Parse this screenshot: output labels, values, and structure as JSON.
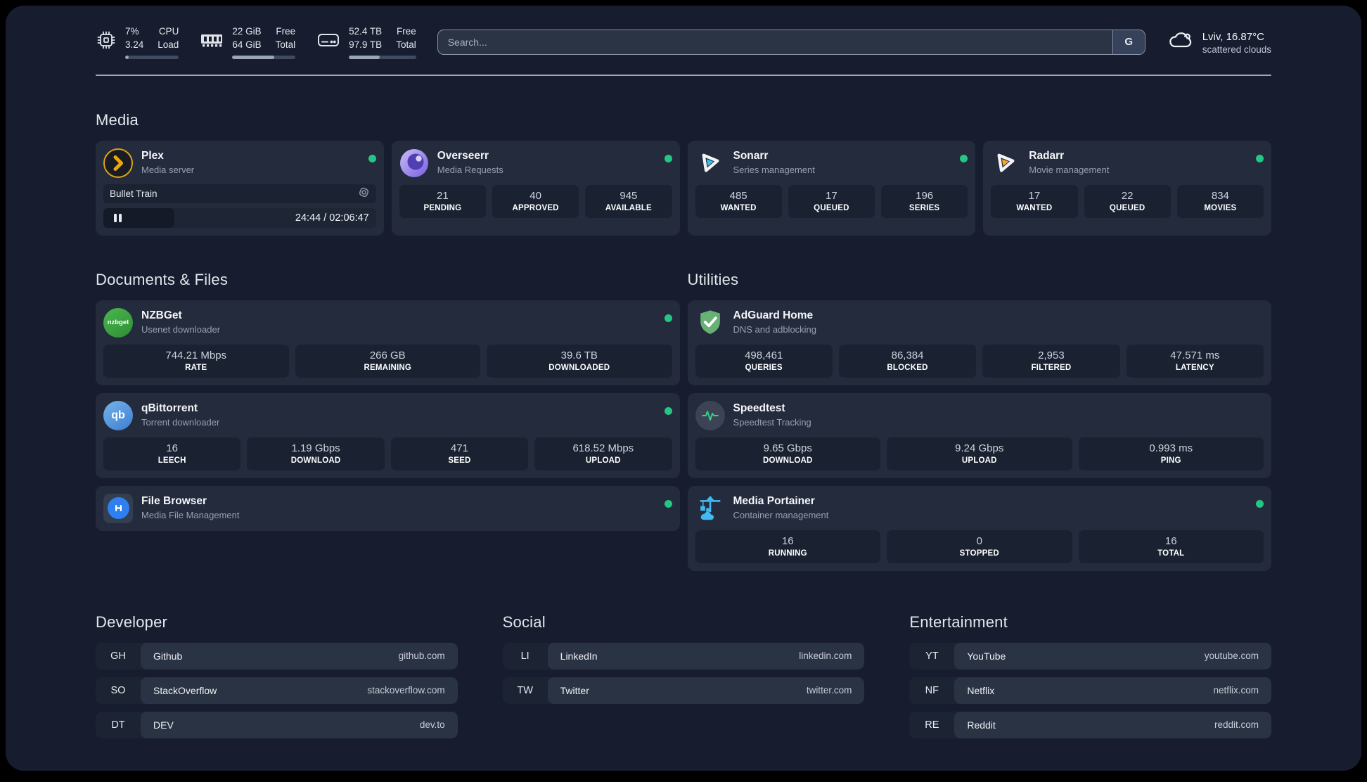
{
  "colors": {
    "status_online": "#25c685"
  },
  "header": {
    "cpu": {
      "value1": "7%",
      "value2": "3.24",
      "label1": "CPU",
      "label2": "Load",
      "percent": 7
    },
    "ram": {
      "value1": "22 GiB",
      "value2": "64 GiB",
      "label1": "Free",
      "label2": "Total",
      "percent": 66
    },
    "disk": {
      "value1": "52.4 TB",
      "value2": "97.9 TB",
      "label1": "Free",
      "label2": "Total",
      "percent": 46
    },
    "search": {
      "placeholder": "Search...",
      "engine": "G"
    },
    "weather": {
      "location": "Lviv, 16.87°C",
      "condition": "scattered clouds"
    }
  },
  "sections": {
    "media": "Media",
    "documents": "Documents & Files",
    "utilities": "Utilities"
  },
  "services": {
    "plex": {
      "name": "Plex",
      "desc": "Media server",
      "online": true,
      "player": {
        "title": "Bullet Train",
        "time": "24:44 / 02:06:47",
        "progress_percent": 26
      }
    },
    "overseerr": {
      "name": "Overseerr",
      "desc": "Media Requests",
      "online": true,
      "stats": [
        {
          "value": "21",
          "label": "PENDING"
        },
        {
          "value": "40",
          "label": "APPROVED"
        },
        {
          "value": "945",
          "label": "AVAILABLE"
        }
      ]
    },
    "sonarr": {
      "name": "Sonarr",
      "desc": "Series management",
      "online": true,
      "stats": [
        {
          "value": "485",
          "label": "WANTED"
        },
        {
          "value": "17",
          "label": "QUEUED"
        },
        {
          "value": "196",
          "label": "SERIES"
        }
      ]
    },
    "radarr": {
      "name": "Radarr",
      "desc": "Movie management",
      "online": true,
      "stats": [
        {
          "value": "17",
          "label": "WANTED"
        },
        {
          "value": "22",
          "label": "QUEUED"
        },
        {
          "value": "834",
          "label": "MOVIES"
        }
      ]
    },
    "nzbget": {
      "name": "NZBGet",
      "desc": "Usenet downloader",
      "online": true,
      "icon_text": "nzbget",
      "stats": [
        {
          "value": "744.21 Mbps",
          "label": "RATE"
        },
        {
          "value": "266 GB",
          "label": "REMAINING"
        },
        {
          "value": "39.6 TB",
          "label": "DOWNLOADED"
        }
      ]
    },
    "qbittorrent": {
      "name": "qBittorrent",
      "desc": "Torrent downloader",
      "online": true,
      "icon_text": "qb",
      "stats": [
        {
          "value": "16",
          "label": "LEECH"
        },
        {
          "value": "1.19 Gbps",
          "label": "DOWNLOAD"
        },
        {
          "value": "471",
          "label": "SEED"
        },
        {
          "value": "618.52 Mbps",
          "label": "UPLOAD"
        }
      ]
    },
    "filebrowser": {
      "name": "File Browser",
      "desc": "Media File Management",
      "online": true
    },
    "adguard": {
      "name": "AdGuard Home",
      "desc": "DNS and adblocking",
      "online": false,
      "stats": [
        {
          "value": "498,461",
          "label": "QUERIES"
        },
        {
          "value": "86,384",
          "label": "BLOCKED"
        },
        {
          "value": "2,953",
          "label": "FILTERED"
        },
        {
          "value": "47.571 ms",
          "label": "LATENCY"
        }
      ]
    },
    "speedtest": {
      "name": "Speedtest",
      "desc": "Speedtest Tracking",
      "online": false,
      "stats": [
        {
          "value": "9.65 Gbps",
          "label": "DOWNLOAD"
        },
        {
          "value": "9.24 Gbps",
          "label": "UPLOAD"
        },
        {
          "value": "0.993 ms",
          "label": "PING"
        }
      ]
    },
    "portainer": {
      "name": "Media Portainer",
      "desc": "Container management",
      "online": true,
      "stats": [
        {
          "value": "16",
          "label": "RUNNING"
        },
        {
          "value": "0",
          "label": "STOPPED"
        },
        {
          "value": "16",
          "label": "TOTAL"
        }
      ]
    }
  },
  "bookmarks": {
    "developer": {
      "title": "Developer",
      "items": [
        {
          "abbr": "GH",
          "name": "Github",
          "url": "github.com"
        },
        {
          "abbr": "SO",
          "name": "StackOverflow",
          "url": "stackoverflow.com"
        },
        {
          "abbr": "DT",
          "name": "DEV",
          "url": "dev.to"
        }
      ]
    },
    "social": {
      "title": "Social",
      "items": [
        {
          "abbr": "LI",
          "name": "LinkedIn",
          "url": "linkedin.com"
        },
        {
          "abbr": "TW",
          "name": "Twitter",
          "url": "twitter.com"
        }
      ]
    },
    "entertainment": {
      "title": "Entertainment",
      "items": [
        {
          "abbr": "YT",
          "name": "YouTube",
          "url": "youtube.com"
        },
        {
          "abbr": "NF",
          "name": "Netflix",
          "url": "netflix.com"
        },
        {
          "abbr": "RE",
          "name": "Reddit",
          "url": "reddit.com"
        }
      ]
    }
  }
}
